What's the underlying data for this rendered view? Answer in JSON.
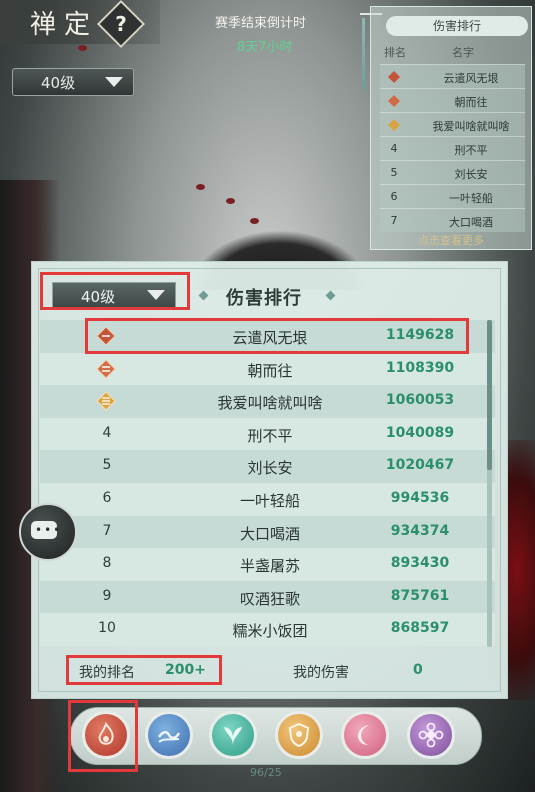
{
  "header": {
    "title": "禅定",
    "help_label": "?",
    "level_selector": "40级"
  },
  "countdown": {
    "label": "赛季结束倒计时",
    "value": "8天7小时"
  },
  "mini_board": {
    "title": "伤害排行",
    "col_rank": "排名",
    "col_name": "名字",
    "rows": [
      {
        "rank": "",
        "name": "云遣风无垠"
      },
      {
        "rank": "",
        "name": "朝而往"
      },
      {
        "rank": "",
        "name": "我爱叫啥就叫啥"
      },
      {
        "rank": "4",
        "name": "刑不平"
      },
      {
        "rank": "5",
        "name": "刘长安"
      },
      {
        "rank": "6",
        "name": "一叶轻船"
      },
      {
        "rank": "7",
        "name": "大口喝酒"
      }
    ],
    "more_link": "点击查看更多"
  },
  "panel": {
    "title": "伤害排行",
    "level_selector": "40级",
    "rows": [
      {
        "rank": "",
        "medal": "gold",
        "name": "云遣风无垠",
        "damage": "1149628"
      },
      {
        "rank": "",
        "medal": "silver",
        "name": "朝而往",
        "damage": "1108390"
      },
      {
        "rank": "",
        "medal": "bronze",
        "name": "我爱叫啥就叫啥",
        "damage": "1060053"
      },
      {
        "rank": "4",
        "medal": "",
        "name": "刑不平",
        "damage": "1040089"
      },
      {
        "rank": "5",
        "medal": "",
        "name": "刘长安",
        "damage": "1020467"
      },
      {
        "rank": "6",
        "medal": "",
        "name": "一叶轻船",
        "damage": "994536"
      },
      {
        "rank": "7",
        "medal": "",
        "name": "大口喝酒",
        "damage": "934374"
      },
      {
        "rank": "8",
        "medal": "",
        "name": "半盏屠苏",
        "damage": "893430"
      },
      {
        "rank": "9",
        "medal": "",
        "name": "叹酒狂歌",
        "damage": "875761"
      },
      {
        "rank": "10",
        "medal": "",
        "name": "糯米小饭团",
        "damage": "868597"
      }
    ],
    "footer": {
      "my_rank_label": "我的排名",
      "my_rank_value": "200+",
      "my_damage_label": "我的伤害",
      "my_damage_value": "0"
    }
  },
  "skills": [
    {
      "name": "fire-school-icon",
      "color": "#c24a3a"
    },
    {
      "name": "wave-school-icon",
      "color": "#4a7fbf"
    },
    {
      "name": "leaf-school-icon",
      "color": "#3fae9a"
    },
    {
      "name": "shield-school-icon",
      "color": "#d49a3a"
    },
    {
      "name": "moon-school-icon",
      "color": "#d86b8a"
    },
    {
      "name": "flower-school-icon",
      "color": "#8a5aa8"
    }
  ],
  "page_counter": "96/25",
  "colors": {
    "highlight": "#e23a3a",
    "damage_text": "#2a8f6a",
    "countdown_text": "#5dd38f"
  }
}
